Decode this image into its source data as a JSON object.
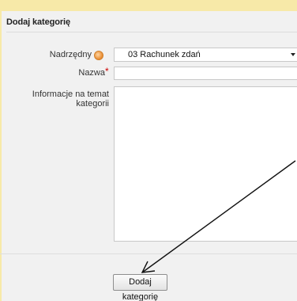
{
  "form": {
    "legend": "Dodaj kategorię",
    "fields": {
      "parent": {
        "label": "Nadrzędny",
        "value": "03 Rachunek zdań"
      },
      "name": {
        "label": "Nazwa",
        "required_mark": "*",
        "value": ""
      },
      "info": {
        "label": "Informacje na temat kategorii",
        "value": ""
      }
    },
    "submit_label": "Dodaj kategorię"
  },
  "colors": {
    "background": "#f9f0c8",
    "panel": "#f1f1f1",
    "required": "#cc0000",
    "help_icon": "#e8892e"
  },
  "icons": {
    "help": "help-icon",
    "dropdown": "chevron-down-icon",
    "annotation": "arrow-annotation"
  }
}
